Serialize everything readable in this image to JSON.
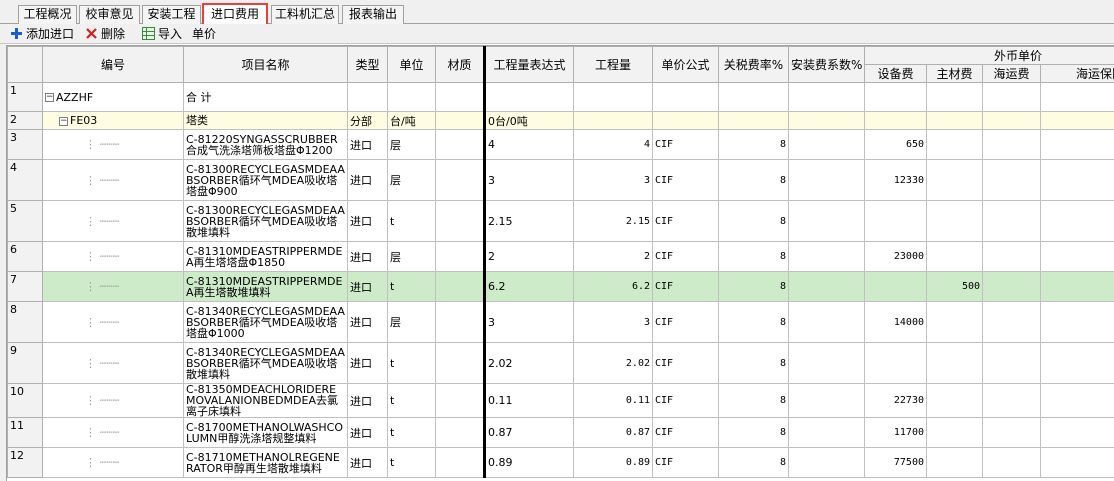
{
  "tabs": [
    "工程概况",
    "校审意见",
    "安装工程",
    "进口费用",
    "工料机汇总",
    "报表输出"
  ],
  "active_tab": "进口费用",
  "toolbar": {
    "add": "添加进口",
    "delete": "删除",
    "import": "导入",
    "unit_price": "单价"
  },
  "header": {
    "code": "编号",
    "name": "项目名称",
    "type": "类型",
    "unit": "单位",
    "material": "材质",
    "qty_expr": "工程量表达式",
    "qty": "工程量",
    "price_formula": "单价公式",
    "tariff": "关税费率%",
    "install_coef": "安装费系数%",
    "foreign_price": "外币单价",
    "equip": "设备费",
    "main_mat": "主材费",
    "freight": "海运费",
    "insurance": "海运保险费"
  },
  "rows": [
    {
      "n": "1",
      "code": "AZZHF",
      "name": "合 计",
      "type": "",
      "unit": "",
      "expr": "",
      "qty": "",
      "formula": "",
      "tariff": "",
      "equip": "",
      "mat": ""
    },
    {
      "n": "2",
      "code": "FE03",
      "name": "塔类",
      "type": "分部",
      "unit": "台/吨",
      "expr": "0台/0吨",
      "qty": "",
      "formula": "",
      "tariff": "",
      "equip": "",
      "mat": ""
    },
    {
      "n": "3",
      "code": "",
      "name": "C-81220SYNGASSCRUBBER合成气洗涤塔筛板塔盘Φ1200",
      "type": "进口",
      "unit": "层",
      "expr": "4",
      "qty": "4",
      "formula": "CIF",
      "tariff": "8",
      "equip": "650",
      "mat": ""
    },
    {
      "n": "4",
      "code": "",
      "name": "C-81300RECYCLEGASMDEAABSORBER循环气MDEA吸收塔塔盘Φ900",
      "type": "进口",
      "unit": "层",
      "expr": "3",
      "qty": "3",
      "formula": "CIF",
      "tariff": "8",
      "equip": "12330",
      "mat": ""
    },
    {
      "n": "5",
      "code": "",
      "name": "C-81300RECYCLEGASMDEAABSORBER循环气MDEA吸收塔散堆填料",
      "type": "进口",
      "unit": "t",
      "expr": "2.15",
      "qty": "2.15",
      "formula": "CIF",
      "tariff": "8",
      "equip": "",
      "mat": ""
    },
    {
      "n": "6",
      "code": "",
      "name": "C-81310MDEASTRIPPERMDEA再生塔塔盘Φ1850",
      "type": "进口",
      "unit": "层",
      "expr": "2",
      "qty": "2",
      "formula": "CIF",
      "tariff": "8",
      "equip": "23000",
      "mat": ""
    },
    {
      "n": "7",
      "code": "",
      "name": "C-81310MDEASTRIPPERMDEA再生塔散堆填料",
      "type": "进口",
      "unit": "t",
      "expr": "6.2",
      "qty": "6.2",
      "formula": "CIF",
      "tariff": "8",
      "equip": "",
      "mat": "500"
    },
    {
      "n": "8",
      "code": "",
      "name": "C-81340RECYCLEGASMDEAABSORBER循环气MDEA吸收塔塔盘Φ1000",
      "type": "进口",
      "unit": "层",
      "expr": "3",
      "qty": "3",
      "formula": "CIF",
      "tariff": "8",
      "equip": "14000",
      "mat": ""
    },
    {
      "n": "9",
      "code": "",
      "name": "C-81340RECYCLEGASMDEAABSORBER循环气MDEA吸收塔散堆填料",
      "type": "进口",
      "unit": "t",
      "expr": "2.02",
      "qty": "2.02",
      "formula": "CIF",
      "tariff": "8",
      "equip": "",
      "mat": ""
    },
    {
      "n": "10",
      "code": "",
      "name": "C-81350MDEACHLORIDEREMOVALANIONBEDMDEA去氯离子床填料",
      "type": "进口",
      "unit": "t",
      "expr": "0.11",
      "qty": "0.11",
      "formula": "CIF",
      "tariff": "8",
      "equip": "22730",
      "mat": ""
    },
    {
      "n": "11",
      "code": "",
      "name": "C-81700METHANOLWASHCOLUMN甲醇洗涤塔规整填料",
      "type": "进口",
      "unit": "t",
      "expr": "0.87",
      "qty": "0.87",
      "formula": "CIF",
      "tariff": "8",
      "equip": "11700",
      "mat": ""
    },
    {
      "n": "12",
      "code": "",
      "name": "C-81710METHANOLREGENERATOR甲醇再生塔散堆填料",
      "type": "进口",
      "unit": "t",
      "expr": "0.89",
      "qty": "0.89",
      "formula": "CIF",
      "tariff": "8",
      "equip": "77500",
      "mat": ""
    }
  ]
}
